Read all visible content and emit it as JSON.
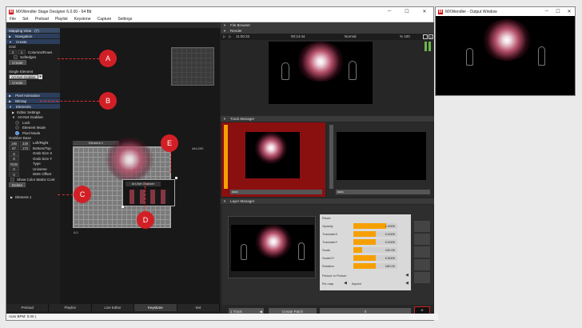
{
  "main_window": {
    "title": "MXWendler Stage Designer 6.0.00  -  64 Bit",
    "menu": [
      "File",
      "Set",
      "Preload",
      "Playlist",
      "Keystone",
      "Capture",
      "Settings"
    ]
  },
  "output_window": {
    "title": "MXWendler - Output Window"
  },
  "left_panel": {
    "mapping_view": {
      "label": "Mapping View",
      "count": "(7)"
    },
    "navigation": "Navigation",
    "create": "Create",
    "grid_label": "Grid",
    "grid_cols": "2",
    "grid_rows": "1",
    "grid_caption": "Columns/Rows",
    "softedges": "Softedges",
    "create_button": "Create",
    "single_element": "Single Element",
    "element_type": "Art-Net Grabbe",
    "create_button2": "Create",
    "pixel_animation": "Pixel Animation",
    "bitmap": "Bitmap",
    "elements": "Elements",
    "editor_settings": "Editor Settings",
    "art_net_grabber": "Art-Net Grabber",
    "modes": [
      "Lock",
      "Element Mode",
      "Pixel Mode"
    ],
    "grabber_base": "Grabber Base",
    "fields": [
      {
        "a": "190",
        "b": "339",
        "label": "Left/Right"
      },
      {
        "a": "67",
        "b": "173",
        "label": "Bottom/Top"
      },
      {
        "a": "8",
        "b": "",
        "label": "Grab Size X"
      },
      {
        "a": "8",
        "b": "",
        "label": "Grab Size Y"
      },
      {
        "a": "RGB",
        "b": "",
        "label": "Type"
      },
      {
        "a": "0",
        "b": "",
        "label": "Universe"
      },
      {
        "a": "0",
        "b": "",
        "label": "DMX Offset"
      }
    ],
    "show_color_matrix": "Show Color Matrix Cont",
    "delete_button": "Delete",
    "element_1": "Element 1"
  },
  "canvas": {
    "element_label": "Element 1",
    "grabber_label": "Art-Net Grabber",
    "coord_top": "444,292",
    "coord_origin": "0,0"
  },
  "callouts": [
    "A",
    "B",
    "C",
    "D",
    "E"
  ],
  "bottom_tabs": [
    "Preload",
    "Playlist",
    "Live Editor",
    "Keystone",
    "Set"
  ],
  "status": "Auto BPM: 0.00 |",
  "file_browser": "File Browser",
  "render": {
    "title": "Render",
    "time": "11:00:32",
    "duration": "00:14:44",
    "blend": "Normal",
    "percent": "% 100"
  },
  "track_manager": {
    "title": "Track Manager",
    "track1": "lada",
    "track2": "lada"
  },
  "layer_manager": {
    "title": "Layer Manager",
    "reset": "Reset",
    "props": [
      {
        "label": "Opacity",
        "value": "1.0000",
        "fill": 0.75
      },
      {
        "label": "TranslateX",
        "value": "0.0000",
        "fill": 0.5
      },
      {
        "label": "TranslateY",
        "value": "0.0000",
        "fill": 0.5
      },
      {
        "label": "Scale",
        "value": "100.00",
        "fill": 0.2
      },
      {
        "label": "ScaleXY",
        "value": "0.5000",
        "fill": 0.5
      },
      {
        "label": "Rotation",
        "value": "180.00",
        "fill": 0.5
      }
    ],
    "pip": "Picture In Picture",
    "remap": "Re-map",
    "remap_value": "Aspect",
    "track_select": "1 Track",
    "create_patch": "Create Patch",
    "patch_value": "0"
  },
  "colors": {
    "accent": "#f5a000",
    "section_header": "#2c3e5c",
    "callout": "#d21f26",
    "track_active": "#8a1010"
  }
}
